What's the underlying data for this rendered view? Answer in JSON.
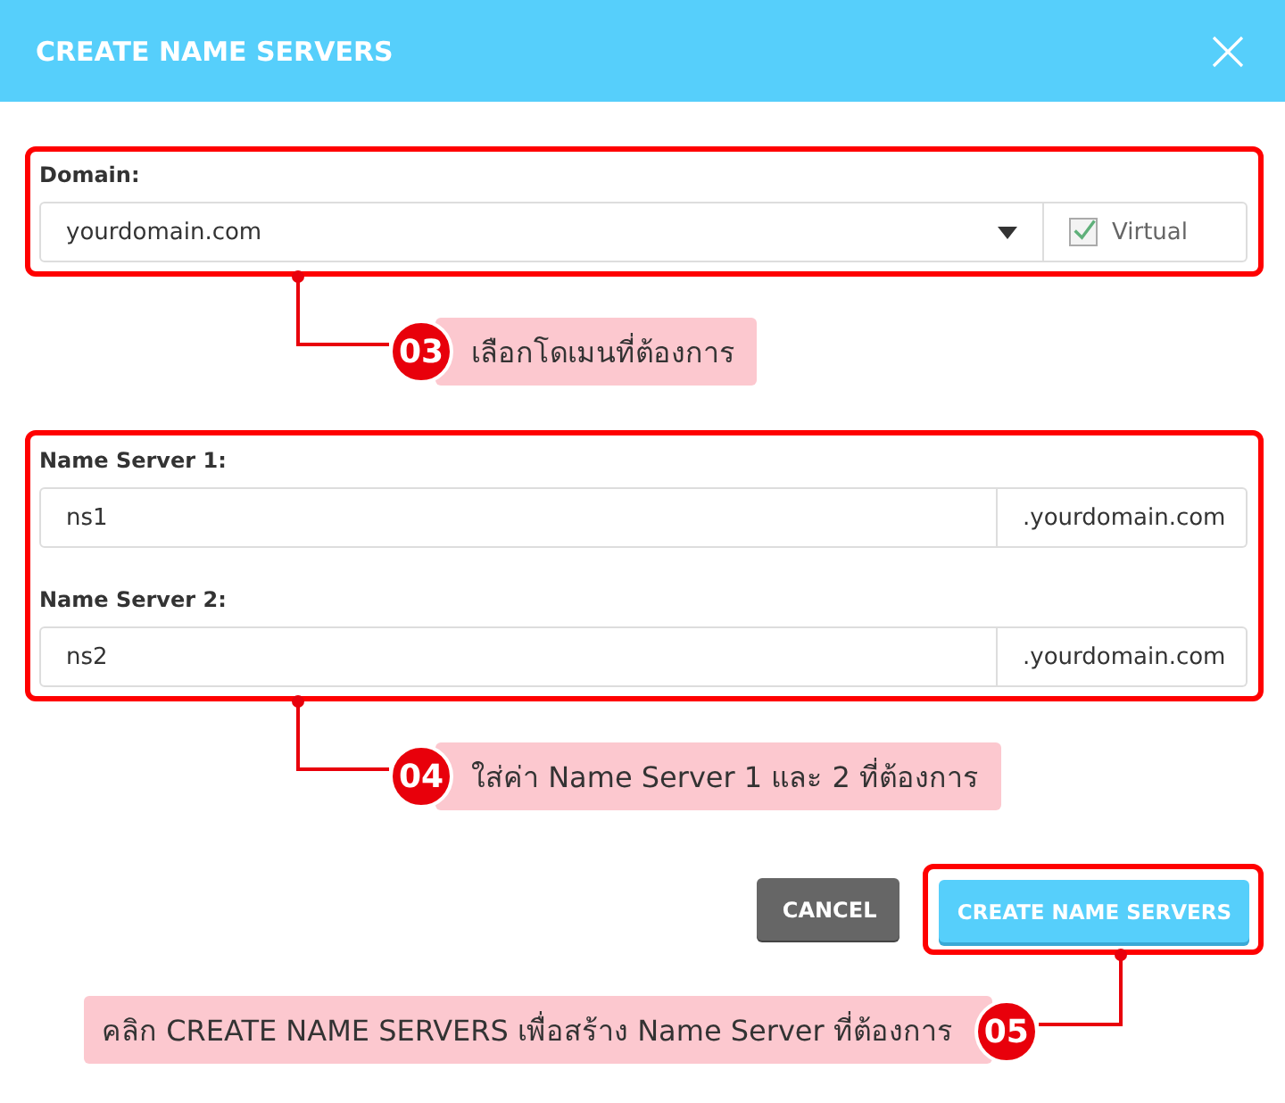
{
  "dialog": {
    "title": "CREATE NAME SERVERS"
  },
  "domain_section": {
    "label": "Domain:",
    "select_value": "yourdomain.com",
    "virtual": {
      "label": "Virtual",
      "checked": true
    },
    "callout": {
      "number": "03",
      "text": "เลือกโดเมนที่ต้องการ"
    }
  },
  "name_server_section": {
    "fields": [
      {
        "label": "Name Server 1:",
        "value": "ns1",
        "suffix": ".yourdomain.com"
      },
      {
        "label": "Name Server 2:",
        "value": "ns2",
        "suffix": ".yourdomain.com"
      }
    ],
    "callout": {
      "number": "04",
      "text": "ใส่ค่า Name Server 1 และ 2 ที่ต้องการ"
    }
  },
  "buttons": [
    {
      "label": "CANCEL",
      "kind": "secondary"
    },
    {
      "label": "CREATE NAME SERVERS",
      "kind": "primary"
    }
  ],
  "button_callout": {
    "number": "05",
    "text": "คลิก CREATE NAME SERVERS เพื่อสร้าง Name Server ที่ต้องการ"
  }
}
